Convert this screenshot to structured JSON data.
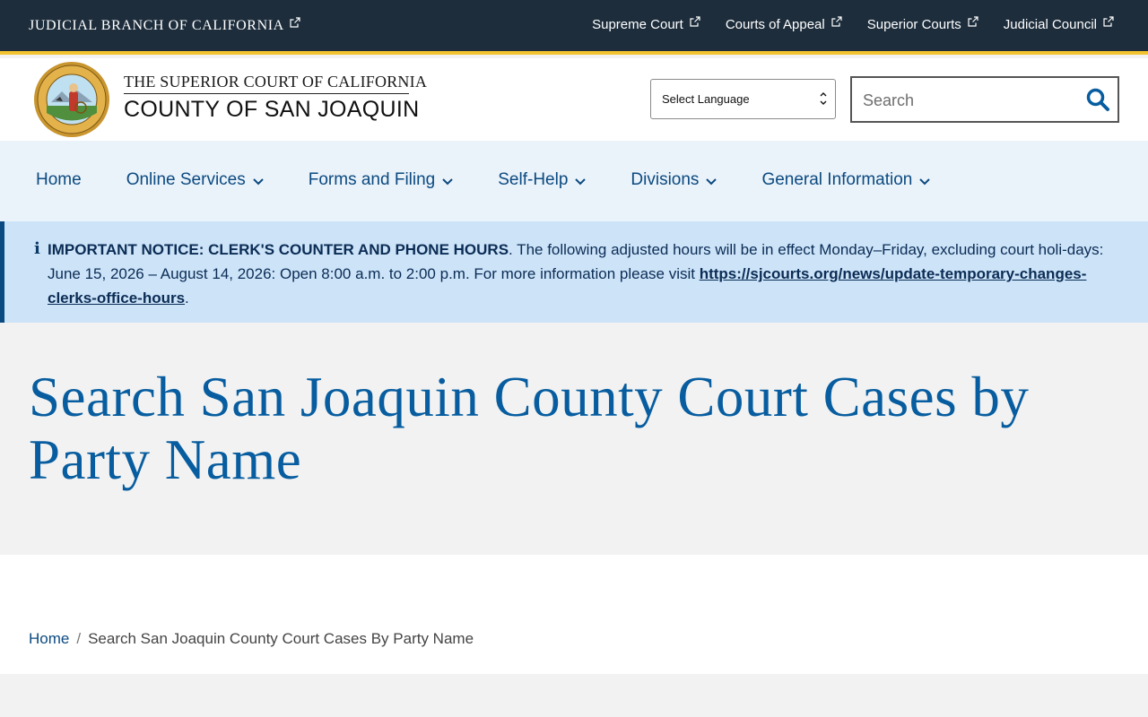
{
  "topbar": {
    "branch_label": "JUDICIAL BRANCH OF CALIFORNIA",
    "links": [
      {
        "label": "Supreme Court"
      },
      {
        "label": "Courts of Appeal"
      },
      {
        "label": "Superior Courts"
      },
      {
        "label": "Judicial Council"
      }
    ]
  },
  "header": {
    "title_top": "THE SUPERIOR COURT OF CALIFORNIA",
    "title_bottom": "COUNTY OF SAN JOAQUIN",
    "seal_text_top": "SUPERIOR COURT OF CALIFORNIA",
    "seal_text_bottom": "COUNTY OF SAN JOAQUIN",
    "seal_motto": "EUREKA",
    "language_select": "Select Language",
    "search_placeholder": "Search"
  },
  "nav": {
    "items": [
      {
        "label": "Home"
      },
      {
        "label": "Online Services"
      },
      {
        "label": "Forms and Filing"
      },
      {
        "label": "Self-Help"
      },
      {
        "label": "Divisions"
      },
      {
        "label": "General Information"
      }
    ]
  },
  "notice": {
    "icon": "info-icon",
    "heading": "IMPORTANT NOTICE: CLERK'S COUNTER AND PHONE HOURS",
    "body": ". The following adjusted hours will be in effect Monday–Friday, excluding court holi-days: June 15, 2026 – August 14, 2026: Open 8:00 a.m. to 2:00 p.m. For more information please visit ",
    "link_text": "https://sjcourts.org/news/update-temporary-changes-clerks-office-hours",
    "trailing": "."
  },
  "page": {
    "title": "Search San Joaquin County Court Cases by Party Name"
  },
  "breadcrumb": {
    "home": "Home",
    "separator": "/",
    "current": "Search San Joaquin County Court Cases By Party Name"
  },
  "colors": {
    "topbar_bg": "#1d2d3c",
    "gold_accent": "#f2c22f",
    "nav_bg": "#eaf2fa",
    "notice_bg": "#cce3f8",
    "title_blue": "#075d9f"
  }
}
